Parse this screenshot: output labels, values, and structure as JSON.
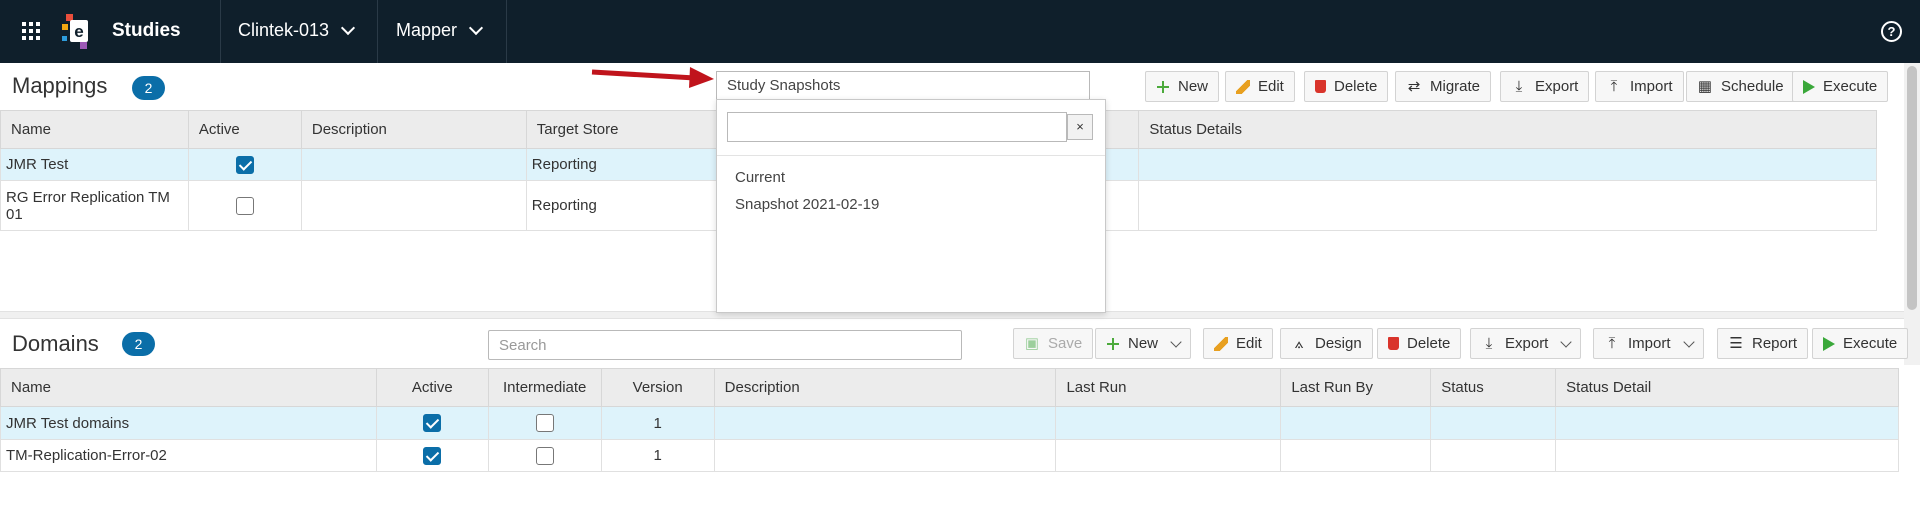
{
  "topbar": {
    "app_title": "Studies",
    "study_dropdown": "Clintek-013",
    "module_dropdown": "Mapper",
    "help_symbol": "?"
  },
  "mappings": {
    "title": "Mappings",
    "count": "2",
    "snapshot_select": "Study Snapshots",
    "toolbar": [
      {
        "label": "New",
        "icon": "plus-icon"
      },
      {
        "label": "Edit",
        "icon": "pencil-icon"
      },
      {
        "label": "Delete",
        "icon": "trash-icon"
      },
      {
        "label": "Migrate",
        "icon": "swap-icon"
      },
      {
        "label": "Export",
        "icon": "download-icon"
      },
      {
        "label": "Import",
        "icon": "upload-icon"
      },
      {
        "label": "Schedule",
        "icon": "calendar-icon"
      },
      {
        "label": "Execute",
        "icon": "play-icon"
      }
    ],
    "columns": [
      "Name",
      "Active",
      "Description",
      "Target Store",
      "Status Details"
    ],
    "rows": [
      {
        "name": "JMR Test",
        "active": true,
        "description": "",
        "target_store": "Reporting",
        "status_details": ""
      },
      {
        "name": "RG Error Replication TM 01",
        "active": false,
        "description": "",
        "target_store": "Reporting",
        "status_details": ""
      }
    ]
  },
  "snapshot_popup": {
    "search_value": "",
    "clear_label": "×",
    "options": [
      "Current",
      "Snapshot 2021-02-19"
    ]
  },
  "domains": {
    "title": "Domains",
    "count": "2",
    "search_placeholder": "Search",
    "toolbar": [
      {
        "label": "Save",
        "icon": "save-icon"
      },
      {
        "label": "New",
        "icon": "plus-icon"
      },
      {
        "label": "Edit",
        "icon": "pencil-icon"
      },
      {
        "label": "Design",
        "icon": "compass-icon"
      },
      {
        "label": "Delete",
        "icon": "trash-icon"
      },
      {
        "label": "Export",
        "icon": "download-icon"
      },
      {
        "label": "Import",
        "icon": "upload-icon"
      },
      {
        "label": "Report",
        "icon": "list-icon"
      },
      {
        "label": "Execute",
        "icon": "play-icon"
      }
    ],
    "columns": [
      "Name",
      "Active",
      "Intermediate",
      "Version",
      "Description",
      "Last Run",
      "Last Run By",
      "Status",
      "Status Detail"
    ],
    "rows": [
      {
        "name": "JMR Test domains",
        "active": true,
        "intermediate": false,
        "version": "1",
        "description": "",
        "last_run": "",
        "last_run_by": "",
        "status": "",
        "status_detail": ""
      },
      {
        "name": "TM-Replication-Error-02",
        "active": true,
        "intermediate": false,
        "version": "1",
        "description": "",
        "last_run": "",
        "last_run_by": "",
        "status": "",
        "status_detail": ""
      }
    ]
  },
  "colors": {
    "topbar_bg": "#0f1f2b",
    "accent_blue": "#0b6ea8",
    "selected_row": "#def3fb",
    "arrow_red": "#c0141c"
  }
}
